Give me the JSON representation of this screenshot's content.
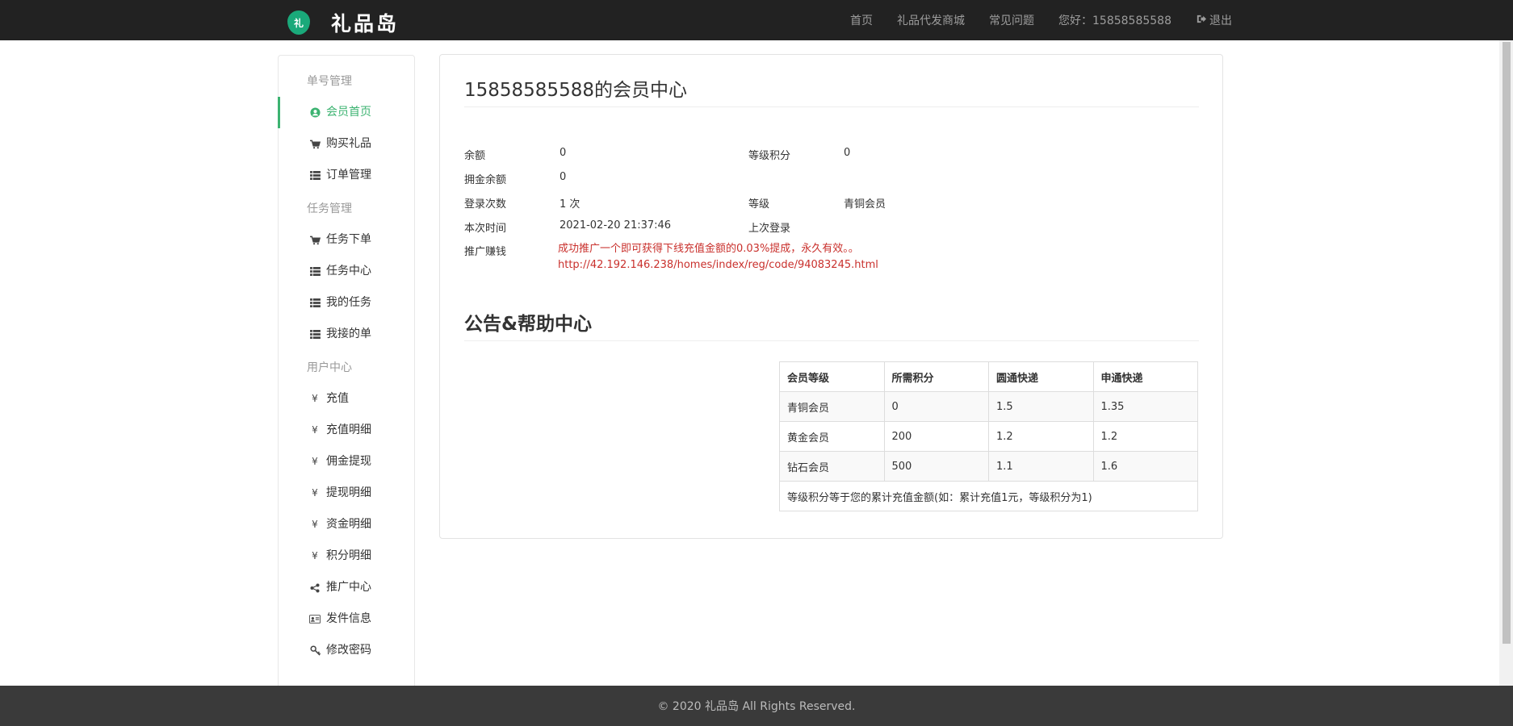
{
  "header": {
    "logo_glyph": "礼",
    "brand_name": "礼品岛",
    "nav": {
      "home": "首页",
      "mall": "礼品代发商城",
      "faq": "常见问题",
      "greeting": "您好：15858585588",
      "logout": "退出"
    }
  },
  "sidebar": {
    "groups": [
      {
        "title": "单号管理",
        "items": [
          "会员首页",
          "购买礼品",
          "订单管理"
        ]
      },
      {
        "title": "任务管理",
        "items": [
          "任务下单",
          "任务中心",
          "我的任务",
          "我接的单"
        ]
      },
      {
        "title": "用户中心",
        "items": [
          "充值",
          "充值明细",
          "佣金提现",
          "提现明细",
          "资金明细",
          "积分明细",
          "推广中心",
          "发件信息",
          "修改密码"
        ]
      }
    ],
    "yen_glyph": "¥"
  },
  "main": {
    "title": "15858585588的会员中心",
    "info": {
      "balance_label": "余额",
      "balance_value": "0",
      "level_points_label": "等级积分",
      "level_points_value": "0",
      "commission_label": "拥金余额",
      "commission_value": "0",
      "login_count_label": "登录次数",
      "login_count_value": "1 次",
      "level_label": "等级",
      "level_value": "青铜会员",
      "this_time_label": "本次时间",
      "this_time_value": "2021-02-20 21:37:46",
      "last_login_label": "上次登录",
      "promo_label": "推广赚钱",
      "promo_text": "成功推广一个即可获得下线充值金额的0.03%提成，永久有效。。",
      "promo_url": "http://42.192.146.238/homes/index/reg/code/94083245.html"
    },
    "notice_title": "公告&帮助中心",
    "table": {
      "headers": [
        "会员等级",
        "所需积分",
        "圆通快递",
        "申通快递"
      ],
      "rows": [
        [
          "青铜会员",
          "0",
          "1.5",
          "1.35"
        ],
        [
          "黄金会员",
          "200",
          "1.2",
          "1.2"
        ],
        [
          "钻石会员",
          "500",
          "1.1",
          "1.6"
        ]
      ],
      "note": "等级积分等于您的累计充值金额(如：累计充值1元，等级积分为1)"
    }
  },
  "footer": {
    "text": "© 2020 礼品岛 All Rights Reserved."
  },
  "colors": {
    "accent": "#3cb371",
    "topbar": "#222222",
    "promo": "#c9302c",
    "footer": "#3a3a3a"
  }
}
